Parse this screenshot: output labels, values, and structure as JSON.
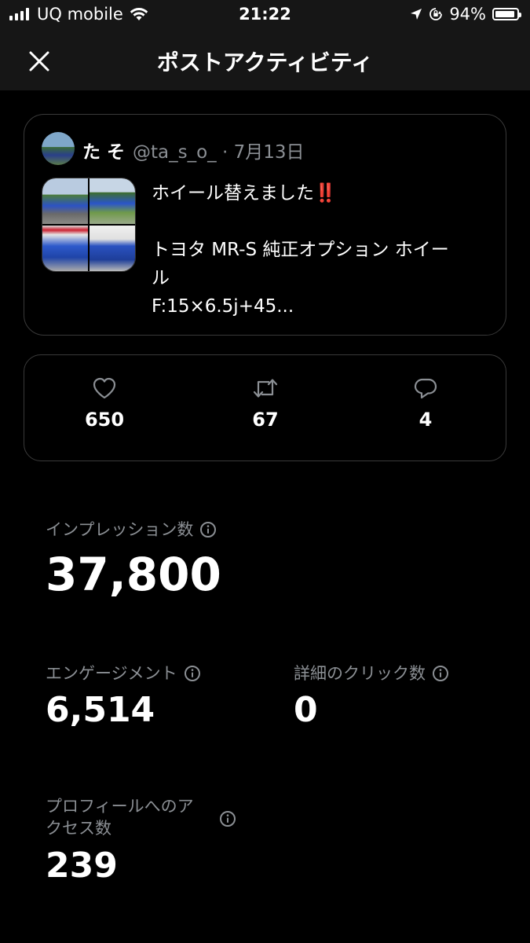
{
  "status_bar": {
    "carrier": "UQ mobile",
    "time": "21:22",
    "battery": "94%",
    "battery_level": 0.94
  },
  "header": {
    "title": "ポストアクティビティ"
  },
  "post": {
    "author_name": "た そ",
    "handle": "@ta_s_o_",
    "separator": "·",
    "date": "7月13日",
    "text_line1": "ホイール替えました",
    "text_emoji": "‼️",
    "text_line2": "トヨタ MR-S 純正オプション ホイー",
    "text_line3": "ル",
    "text_line4": "F:15×6.5j+45..."
  },
  "engagement": {
    "likes": "650",
    "reposts": "67",
    "replies": "4"
  },
  "metrics": {
    "impressions_label": "インプレッション数",
    "impressions_value": "37,800",
    "engagements_label": "エンゲージメント",
    "engagements_value": "6,514",
    "detail_clicks_label": "詳細のクリック数",
    "detail_clicks_value": "0",
    "profile_visits_label_1": "プロフィールへのア",
    "profile_visits_label_2": "クセス数",
    "profile_visits_value": "239"
  }
}
